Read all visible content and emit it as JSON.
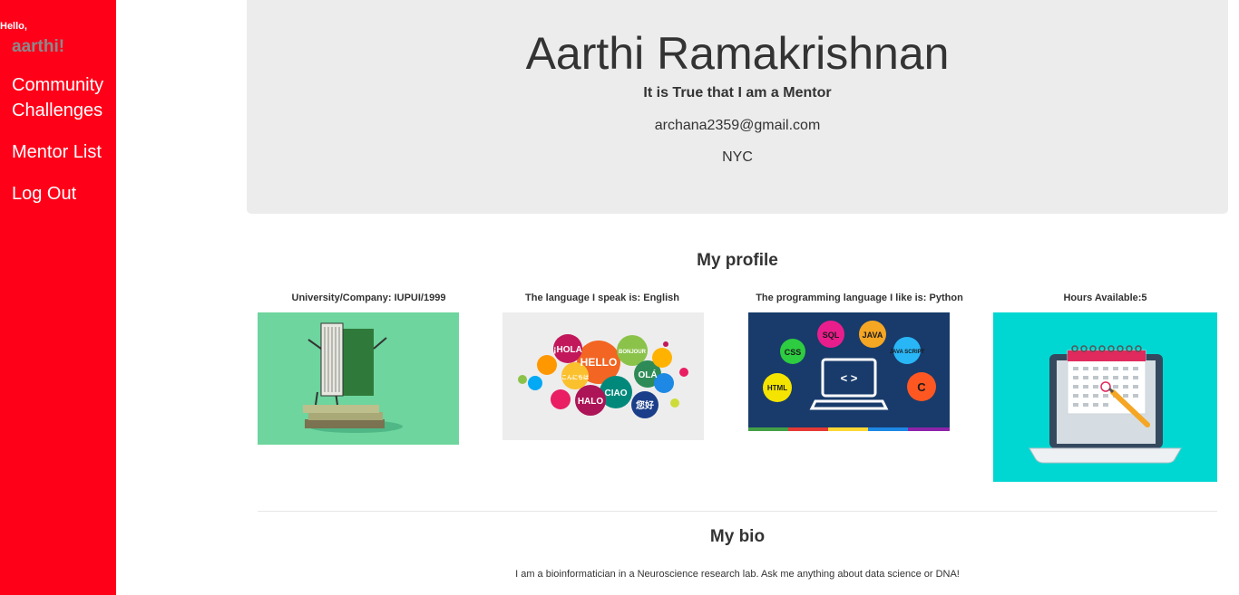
{
  "sidebar": {
    "greeting": "Hello,",
    "username": "aarthi!",
    "links": {
      "community": "Community Challenges",
      "mentors": "Mentor List",
      "logout": "Log Out"
    },
    "colors": {
      "background": "#ff0019",
      "username": "#8a8a8a"
    }
  },
  "profile": {
    "name": "Aarthi Ramakrishnan",
    "mentor_status": "It is True that I am a Mentor",
    "email": "archana2359@gmail.com",
    "city": "NYC"
  },
  "my_profile": {
    "title": "My profile",
    "cards": [
      {
        "label": "University/Company: IUPUI/1999",
        "image": "book-on-books-illustration"
      },
      {
        "label": "The language I speak is: English",
        "image": "language-speech-bubbles-illustration",
        "bubble_words": [
          "¡HOLA",
          "HELLO",
          "BONJOUR",
          "OLÁ",
          "CIAO",
          "HALO",
          "您好",
          "こんにちは"
        ]
      },
      {
        "label": "The programming language I like is: Python",
        "image": "laptop-programming-languages-illustration",
        "bubble_words": [
          "CSS",
          "SQL",
          "JAVA",
          "JAVA SCRIPT",
          "HTML",
          "C",
          "< >"
        ]
      },
      {
        "label": "Hours Available:5",
        "image": "laptop-calendar-illustration"
      }
    ]
  },
  "bio": {
    "title": "My bio",
    "text": "I am a bioinformatician in a Neuroscience research lab. Ask me anything about data science or DNA!"
  }
}
